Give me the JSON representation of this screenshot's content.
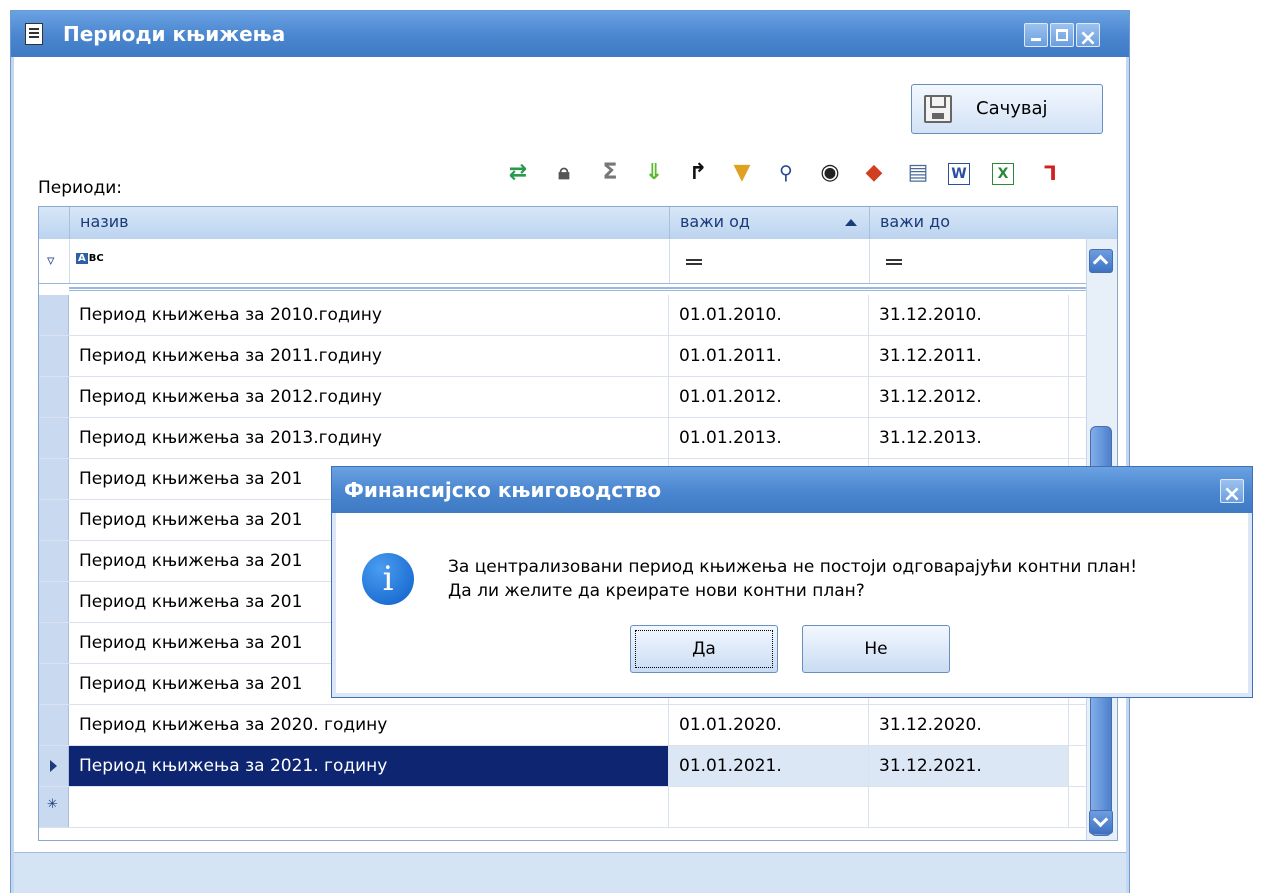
{
  "window": {
    "title": "Периоди књижења"
  },
  "toolbar": {
    "save_label": "Сачувај",
    "periods_label": "Периоди:"
  },
  "grid": {
    "columns": [
      "назив",
      "важи од",
      "важи до"
    ],
    "filter": {
      "c2": "=",
      "c3": "="
    },
    "rows": [
      {
        "name": "Период књижења за 2010.годину",
        "from": "01.01.2010.",
        "to": "31.12.2010."
      },
      {
        "name": "Период књижења за 2011.годину",
        "from": "01.01.2011.",
        "to": "31.12.2011."
      },
      {
        "name": "Период књижења за 2012.годину",
        "from": "01.01.2012.",
        "to": "31.12.2012."
      },
      {
        "name": "Период књижења за 2013.годину",
        "from": "01.01.2013.",
        "to": "31.12.2013."
      },
      {
        "name": "Период књижења за 201",
        "from": "",
        "to": ""
      },
      {
        "name": "Период књижења за 201",
        "from": "",
        "to": ""
      },
      {
        "name": "Период књижења за 201",
        "from": "",
        "to": ""
      },
      {
        "name": "Период књижења за 201",
        "from": "",
        "to": ""
      },
      {
        "name": "Период књижења за 201",
        "from": "",
        "to": ""
      },
      {
        "name": "Период књижења за 201",
        "from": "",
        "to": ""
      },
      {
        "name": "Период књижења за 2020. годину",
        "from": "01.01.2020.",
        "to": "31.12.2020."
      },
      {
        "name": "Период књижења за 2021. годину",
        "from": "01.01.2021.",
        "to": "31.12.2021."
      },
      {
        "name": "",
        "from": "",
        "to": ""
      }
    ]
  },
  "dialog": {
    "title": "Финансијско књиговодство",
    "message_line1": "За централизовани период књижења не постоји одговарајући контни план!",
    "message_line2": "Да ли желите да креирате нови контни план?",
    "yes_label": "Да",
    "no_label": "Не"
  },
  "icons": [
    "refresh-icon",
    "lock-icon",
    "sum-icon",
    "expand-icon",
    "goto-icon",
    "filter-icon",
    "find-icon",
    "preview-icon",
    "layout-icon",
    "print-icon",
    "word-export-icon",
    "excel-export-icon",
    "pdf-export-icon"
  ]
}
